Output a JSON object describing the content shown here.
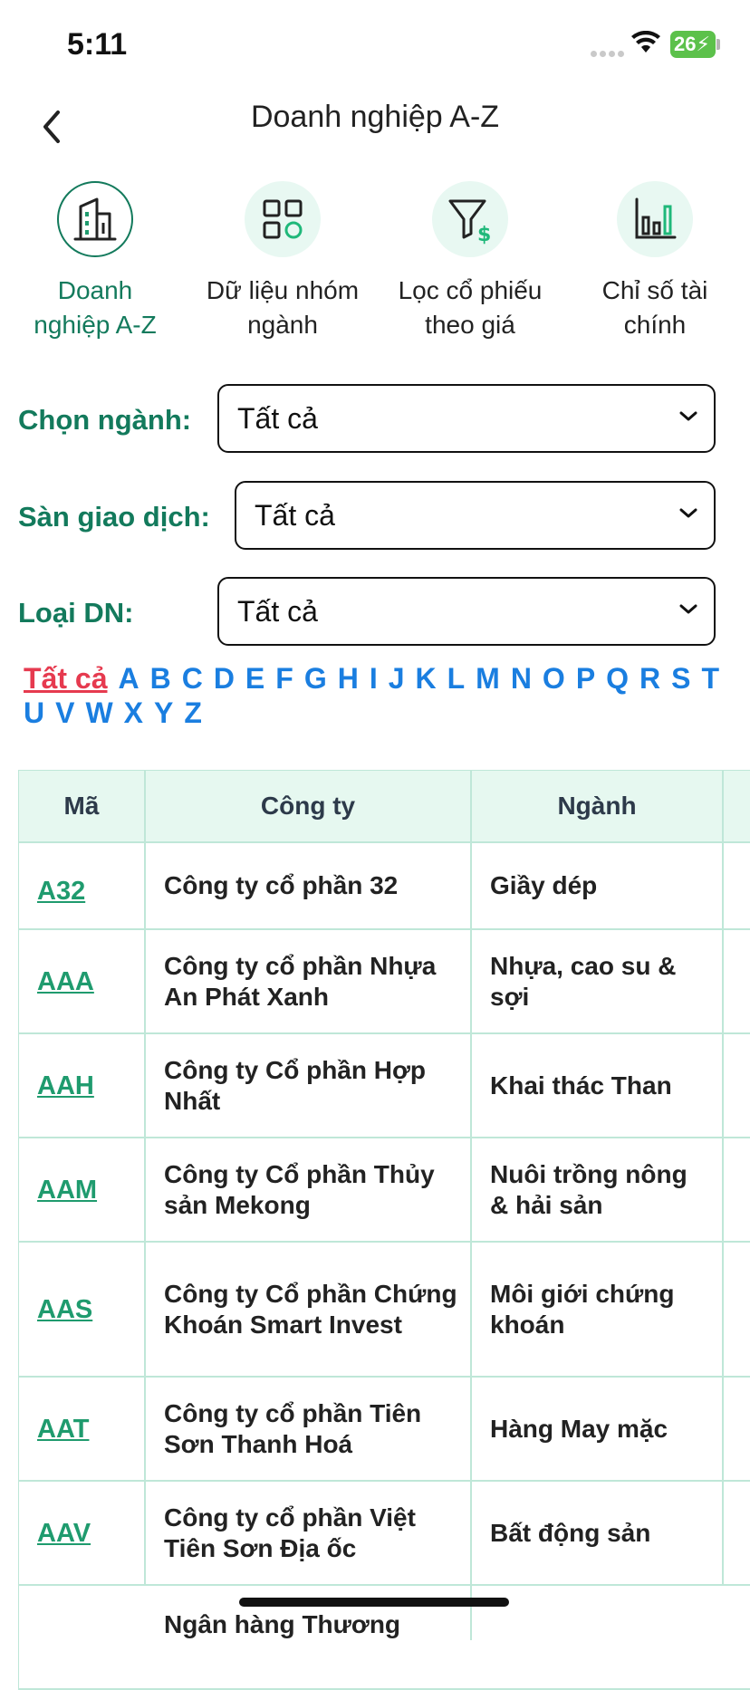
{
  "status": {
    "time": "5:11",
    "battery": "26"
  },
  "header": {
    "title": "Doanh nghiệp A-Z"
  },
  "tabs": [
    {
      "line1": "Doanh",
      "line2": "nghiệp A-Z",
      "icon": "building-icon",
      "active": true
    },
    {
      "line1": "Dữ liệu nhóm",
      "line2": "ngành",
      "icon": "grid-icon",
      "active": false
    },
    {
      "line1": "Lọc cổ phiếu",
      "line2": "theo giá",
      "icon": "filter-dollar-icon",
      "active": false
    },
    {
      "line1": "Chỉ số tài",
      "line2": "chính",
      "icon": "bar-chart-icon",
      "active": false
    }
  ],
  "filters": {
    "industry": {
      "label": "Chọn ngành:",
      "value": "Tất cả"
    },
    "exchange": {
      "label": "Sàn giao dịch:",
      "value": "Tất cả"
    },
    "type": {
      "label": "Loại DN:",
      "value": "Tất cả"
    }
  },
  "alphabet": {
    "all": "Tất cả",
    "letters": [
      "A",
      "B",
      "C",
      "D",
      "E",
      "F",
      "G",
      "H",
      "I",
      "J",
      "K",
      "L",
      "M",
      "N",
      "O",
      "P",
      "Q",
      "R",
      "S",
      "T",
      "U",
      "V",
      "W",
      "X",
      "Y",
      "Z"
    ]
  },
  "table": {
    "headers": [
      "Mã",
      "Công ty",
      "Ngành"
    ],
    "rows": [
      {
        "code": "A32",
        "company": "Công ty cổ phần 32",
        "industry": "Giầy dép"
      },
      {
        "code": "AAA",
        "company": "Công ty cổ phần Nhựa An Phát Xanh",
        "industry": "Nhựa, cao su & sợi"
      },
      {
        "code": "AAH",
        "company": "Công ty Cổ phần Hợp Nhất",
        "industry": "Khai thác Than"
      },
      {
        "code": "AAM",
        "company": "Công ty Cổ phần Thủy sản Mekong",
        "industry": "Nuôi trồng nông & hải sản"
      },
      {
        "code": "AAS",
        "company": "Công ty Cổ phần Chứng Khoán Smart Invest",
        "industry": "Môi giới chứng khoán"
      },
      {
        "code": "AAT",
        "company": "Công ty cổ phần Tiên Sơn Thanh Hoá",
        "industry": "Hàng May mặc"
      },
      {
        "code": "AAV",
        "company": "Công ty cổ phần Việt Tiên Sơn Địa ốc",
        "industry": "Bất động sản"
      },
      {
        "code": "",
        "company": "Ngân hàng Thương",
        "industry": ""
      }
    ]
  },
  "colors": {
    "accent": "#137a5c",
    "link": "#1a7ee0",
    "active_letter": "#e63a4f",
    "table_head": "#e6f8f0"
  }
}
